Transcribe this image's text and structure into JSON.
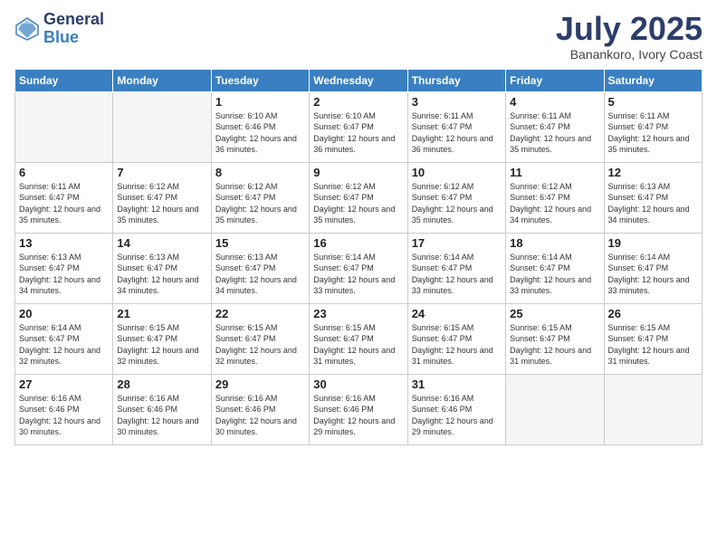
{
  "logo": {
    "general": "General",
    "blue": "Blue"
  },
  "title": {
    "month": "July 2025",
    "location": "Banankoro, Ivory Coast"
  },
  "weekdays": [
    "Sunday",
    "Monday",
    "Tuesday",
    "Wednesday",
    "Thursday",
    "Friday",
    "Saturday"
  ],
  "weeks": [
    [
      {
        "day": "",
        "info": ""
      },
      {
        "day": "",
        "info": ""
      },
      {
        "day": "1",
        "info": "Sunrise: 6:10 AM\nSunset: 6:46 PM\nDaylight: 12 hours\nand 36 minutes."
      },
      {
        "day": "2",
        "info": "Sunrise: 6:10 AM\nSunset: 6:47 PM\nDaylight: 12 hours\nand 36 minutes."
      },
      {
        "day": "3",
        "info": "Sunrise: 6:11 AM\nSunset: 6:47 PM\nDaylight: 12 hours\nand 36 minutes."
      },
      {
        "day": "4",
        "info": "Sunrise: 6:11 AM\nSunset: 6:47 PM\nDaylight: 12 hours\nand 35 minutes."
      },
      {
        "day": "5",
        "info": "Sunrise: 6:11 AM\nSunset: 6:47 PM\nDaylight: 12 hours\nand 35 minutes."
      }
    ],
    [
      {
        "day": "6",
        "info": "Sunrise: 6:11 AM\nSunset: 6:47 PM\nDaylight: 12 hours\nand 35 minutes."
      },
      {
        "day": "7",
        "info": "Sunrise: 6:12 AM\nSunset: 6:47 PM\nDaylight: 12 hours\nand 35 minutes."
      },
      {
        "day": "8",
        "info": "Sunrise: 6:12 AM\nSunset: 6:47 PM\nDaylight: 12 hours\nand 35 minutes."
      },
      {
        "day": "9",
        "info": "Sunrise: 6:12 AM\nSunset: 6:47 PM\nDaylight: 12 hours\nand 35 minutes."
      },
      {
        "day": "10",
        "info": "Sunrise: 6:12 AM\nSunset: 6:47 PM\nDaylight: 12 hours\nand 35 minutes."
      },
      {
        "day": "11",
        "info": "Sunrise: 6:12 AM\nSunset: 6:47 PM\nDaylight: 12 hours\nand 34 minutes."
      },
      {
        "day": "12",
        "info": "Sunrise: 6:13 AM\nSunset: 6:47 PM\nDaylight: 12 hours\nand 34 minutes."
      }
    ],
    [
      {
        "day": "13",
        "info": "Sunrise: 6:13 AM\nSunset: 6:47 PM\nDaylight: 12 hours\nand 34 minutes."
      },
      {
        "day": "14",
        "info": "Sunrise: 6:13 AM\nSunset: 6:47 PM\nDaylight: 12 hours\nand 34 minutes."
      },
      {
        "day": "15",
        "info": "Sunrise: 6:13 AM\nSunset: 6:47 PM\nDaylight: 12 hours\nand 34 minutes."
      },
      {
        "day": "16",
        "info": "Sunrise: 6:14 AM\nSunset: 6:47 PM\nDaylight: 12 hours\nand 33 minutes."
      },
      {
        "day": "17",
        "info": "Sunrise: 6:14 AM\nSunset: 6:47 PM\nDaylight: 12 hours\nand 33 minutes."
      },
      {
        "day": "18",
        "info": "Sunrise: 6:14 AM\nSunset: 6:47 PM\nDaylight: 12 hours\nand 33 minutes."
      },
      {
        "day": "19",
        "info": "Sunrise: 6:14 AM\nSunset: 6:47 PM\nDaylight: 12 hours\nand 33 minutes."
      }
    ],
    [
      {
        "day": "20",
        "info": "Sunrise: 6:14 AM\nSunset: 6:47 PM\nDaylight: 12 hours\nand 32 minutes."
      },
      {
        "day": "21",
        "info": "Sunrise: 6:15 AM\nSunset: 6:47 PM\nDaylight: 12 hours\nand 32 minutes."
      },
      {
        "day": "22",
        "info": "Sunrise: 6:15 AM\nSunset: 6:47 PM\nDaylight: 12 hours\nand 32 minutes."
      },
      {
        "day": "23",
        "info": "Sunrise: 6:15 AM\nSunset: 6:47 PM\nDaylight: 12 hours\nand 31 minutes."
      },
      {
        "day": "24",
        "info": "Sunrise: 6:15 AM\nSunset: 6:47 PM\nDaylight: 12 hours\nand 31 minutes."
      },
      {
        "day": "25",
        "info": "Sunrise: 6:15 AM\nSunset: 6:47 PM\nDaylight: 12 hours\nand 31 minutes."
      },
      {
        "day": "26",
        "info": "Sunrise: 6:15 AM\nSunset: 6:47 PM\nDaylight: 12 hours\nand 31 minutes."
      }
    ],
    [
      {
        "day": "27",
        "info": "Sunrise: 6:16 AM\nSunset: 6:46 PM\nDaylight: 12 hours\nand 30 minutes."
      },
      {
        "day": "28",
        "info": "Sunrise: 6:16 AM\nSunset: 6:46 PM\nDaylight: 12 hours\nand 30 minutes."
      },
      {
        "day": "29",
        "info": "Sunrise: 6:16 AM\nSunset: 6:46 PM\nDaylight: 12 hours\nand 30 minutes."
      },
      {
        "day": "30",
        "info": "Sunrise: 6:16 AM\nSunset: 6:46 PM\nDaylight: 12 hours\nand 29 minutes."
      },
      {
        "day": "31",
        "info": "Sunrise: 6:16 AM\nSunset: 6:46 PM\nDaylight: 12 hours\nand 29 minutes."
      },
      {
        "day": "",
        "info": ""
      },
      {
        "day": "",
        "info": ""
      }
    ]
  ]
}
